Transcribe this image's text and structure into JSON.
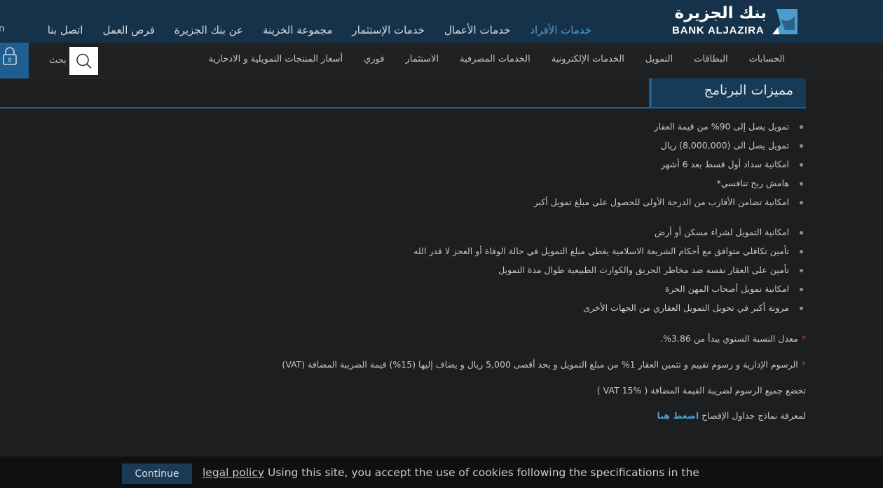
{
  "brand": {
    "name_ar": "بنك الجزيرة",
    "name_en": "BANK ALJAZIRA"
  },
  "main_nav": [
    {
      "label": "خدمات الأفراد",
      "active": true
    },
    {
      "label": "خدمات الأعمال",
      "active": false
    },
    {
      "label": "خدمات الإستثمار",
      "active": false
    },
    {
      "label": "مجموعة الخزينة",
      "active": false
    },
    {
      "label": "عن بنك الجزيرة",
      "active": false
    },
    {
      "label": "فرص العمل",
      "active": false
    },
    {
      "label": "اتصل بنا",
      "active": false
    }
  ],
  "main_nav_edge": "ח",
  "sub_nav": [
    {
      "label": "الحسابات"
    },
    {
      "label": "البطاقات"
    },
    {
      "label": "التمويل"
    },
    {
      "label": "الخدمات الإلكترونية"
    },
    {
      "label": "الخدمات المصرفية"
    },
    {
      "label": "الاستثمار"
    },
    {
      "label": "فوري"
    },
    {
      "label": "أسعار المنتجات التمويلية و الادخارية"
    }
  ],
  "search": {
    "label": "بحث"
  },
  "lock_badge": "8",
  "section": {
    "title": "مميزات البرنامج"
  },
  "features": [
    "تمويل يصل إلى 90% من قيمة العقار",
    "تمويل يصل الى (8,000,000) ريال",
    "امكانية سداد أول قسط بعد 6 أشهر",
    "هامش ربح تنافسي*",
    "امكانية تضامن الأقارب من الدرجة الأولى للحصول على مبلغ تمويل أكبر",
    "امكانية التمويل لشراء مسكن أو أرض",
    "تأمين تكافلي متوافق مع أحكام الشريعة الاسلامية يغطي مبلغ التمويل في حالة الوفاة أو العجز لا قدر الله",
    "تأمين على العقار نفسه ضد مخاطر الحريق والكوارث الطبيعية طوال مدة التمويل",
    "امكانية تمويل أصحاب المهن الحرة",
    "مرونة أكبر في تحويل التمويل العقاري من الجهات الأخرى"
  ],
  "notes": {
    "rate": "معدل النسبة السنوي يبدأ من 3.86%.",
    "fees": "الرسوم الإدارية و رسوم تقييم و تثمين العقار 1% من مبلغ التمويل و بحد أقصى 5,000 ريال و يضاف إليها (15%) قيمة الضريبة المضافة (VAT)",
    "vat": "تخضع جميع الرسوم لضريبة القيمة المضافة ( VAT 15% )",
    "schedule": "لمعرفة نماذج جداول الإفصاح",
    "schedule_link": "اضغط هنا"
  },
  "cookie": {
    "button": "Continue",
    "link": "legal policy",
    "text": " Using this site, you accept the use of cookies following the specifications in the"
  },
  "colors": {
    "header_bg": "#16324a",
    "accent": "#4e9ccf",
    "page_bg": "#1c1e1f",
    "required_star": "#d23a3a"
  }
}
